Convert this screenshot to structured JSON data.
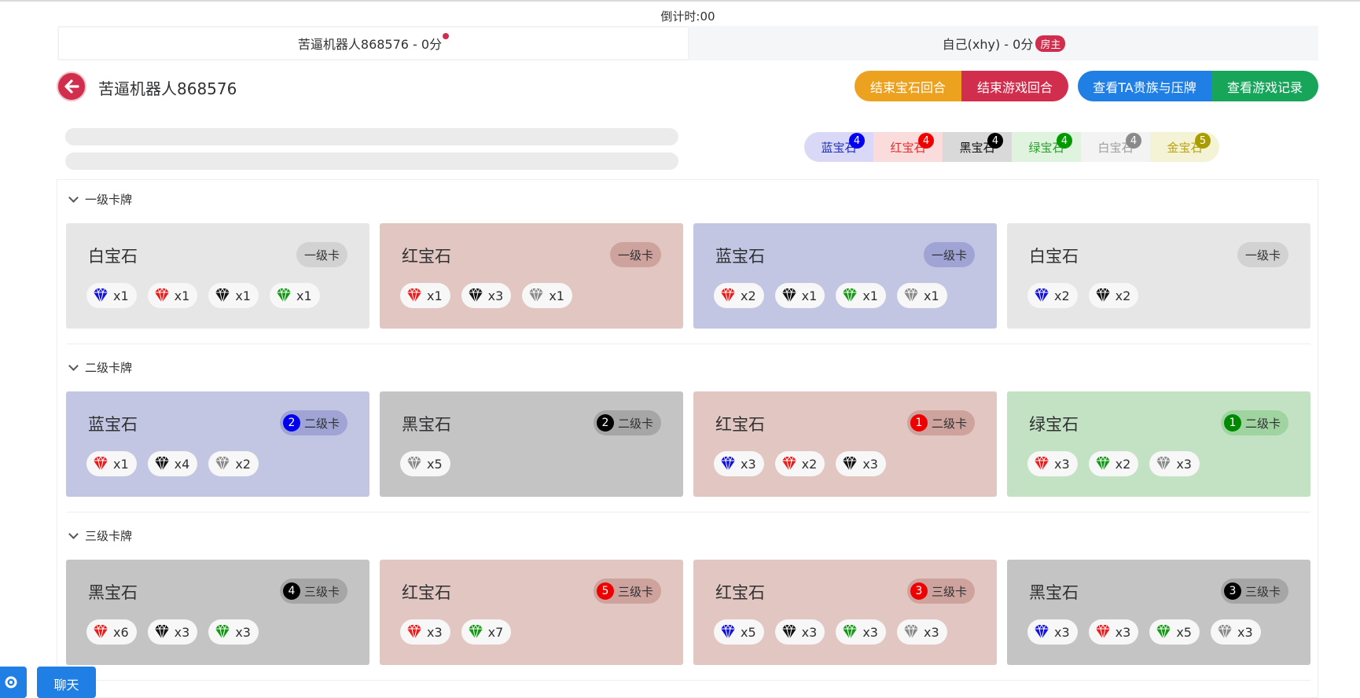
{
  "countdown": "倒计时:00",
  "players": [
    {
      "label": "苦逼机器人868576 - 0分",
      "active": true,
      "dot": true
    },
    {
      "label": "自己(xhy) - 0分",
      "active": false,
      "badge": "房主"
    }
  ],
  "current_player": "苦逼机器人868576",
  "actions": {
    "end_gem_round": "结束宝石回合",
    "end_game_round": "结束游戏回合",
    "view_nobles": "查看TA贵族与压牌",
    "view_records": "查看游戏记录"
  },
  "gem_bank": [
    {
      "name": "蓝宝石",
      "count": "4",
      "text_color": "#1f31b8",
      "bg": "#d9d9f7",
      "badge": "#0000ee"
    },
    {
      "name": "红宝石",
      "count": "4",
      "text_color": "#e0302c",
      "bg": "#fbdcdc",
      "badge": "#ee0000"
    },
    {
      "name": "黑宝石",
      "count": "4",
      "text_color": "#111111",
      "bg": "#d9d9d9",
      "badge": "#000000"
    },
    {
      "name": "绿宝石",
      "count": "4",
      "text_color": "#27a027",
      "bg": "#dff3df",
      "badge": "#009900"
    },
    {
      "name": "白宝石",
      "count": "4",
      "text_color": "#a0a0a0",
      "bg": "#f3f3f3",
      "badge": "#8a8a8a"
    },
    {
      "name": "金宝石",
      "count": "5",
      "text_color": "#b8a30f",
      "bg": "#f5f3d6",
      "badge": "#a89c00"
    }
  ],
  "sections": [
    {
      "title": "一级卡牌",
      "cards": [
        {
          "gem": "白宝石",
          "bg": "#e6e6e6",
          "badge_bg": "#d2d2d2",
          "level": "一级卡",
          "num": "",
          "num_color": "",
          "costs": [
            {
              "color": "blue",
              "qty": "x1"
            },
            {
              "color": "red",
              "qty": "x1"
            },
            {
              "color": "black",
              "qty": "x1"
            },
            {
              "color": "green",
              "qty": "x1"
            }
          ]
        },
        {
          "gem": "红宝石",
          "bg": "#e2c6c2",
          "badge_bg": "#cfa39d",
          "level": "一级卡",
          "num": "",
          "num_color": "",
          "costs": [
            {
              "color": "red",
              "qty": "x1"
            },
            {
              "color": "black",
              "qty": "x3"
            },
            {
              "color": "grey",
              "qty": "x1"
            }
          ]
        },
        {
          "gem": "蓝宝石",
          "bg": "#c3c6e2",
          "badge_bg": "#a0a4d4",
          "level": "一级卡",
          "num": "",
          "num_color": "",
          "costs": [
            {
              "color": "red",
              "qty": "x2"
            },
            {
              "color": "black",
              "qty": "x1"
            },
            {
              "color": "green",
              "qty": "x1"
            },
            {
              "color": "grey",
              "qty": "x1"
            }
          ]
        },
        {
          "gem": "白宝石",
          "bg": "#e6e6e6",
          "badge_bg": "#d2d2d2",
          "level": "一级卡",
          "num": "",
          "num_color": "",
          "costs": [
            {
              "color": "blue",
              "qty": "x2"
            },
            {
              "color": "black",
              "qty": "x2"
            }
          ]
        }
      ]
    },
    {
      "title": "二级卡牌",
      "cards": [
        {
          "gem": "蓝宝石",
          "bg": "#c3c6e2",
          "badge_bg": "#a0a4d4",
          "level": "二级卡",
          "num": "2",
          "num_color": "#0000ee",
          "costs": [
            {
              "color": "red",
              "qty": "x1"
            },
            {
              "color": "black",
              "qty": "x4"
            },
            {
              "color": "grey",
              "qty": "x2"
            }
          ]
        },
        {
          "gem": "黑宝石",
          "bg": "#c4c4c4",
          "badge_bg": "#a6a6a6",
          "level": "二级卡",
          "num": "2",
          "num_color": "#000000",
          "costs": [
            {
              "color": "grey",
              "qty": "x5"
            }
          ]
        },
        {
          "gem": "红宝石",
          "bg": "#e2c6c2",
          "badge_bg": "#cfa39d",
          "level": "二级卡",
          "num": "1",
          "num_color": "#ee0000",
          "costs": [
            {
              "color": "blue",
              "qty": "x3"
            },
            {
              "color": "red",
              "qty": "x2"
            },
            {
              "color": "black",
              "qty": "x3"
            }
          ]
        },
        {
          "gem": "绿宝石",
          "bg": "#c3e2c3",
          "badge_bg": "#9fd39f",
          "level": "二级卡",
          "num": "1",
          "num_color": "#008800",
          "costs": [
            {
              "color": "red",
              "qty": "x3"
            },
            {
              "color": "green",
              "qty": "x2"
            },
            {
              "color": "grey",
              "qty": "x3"
            }
          ]
        }
      ]
    },
    {
      "title": "三级卡牌",
      "cards": [
        {
          "gem": "黑宝石",
          "bg": "#c4c4c4",
          "badge_bg": "#a6a6a6",
          "level": "三级卡",
          "num": "4",
          "num_color": "#000000",
          "costs": [
            {
              "color": "red",
              "qty": "x6"
            },
            {
              "color": "black",
              "qty": "x3"
            },
            {
              "color": "green",
              "qty": "x3"
            }
          ]
        },
        {
          "gem": "红宝石",
          "bg": "#e2c6c2",
          "badge_bg": "#cfa39d",
          "level": "三级卡",
          "num": "5",
          "num_color": "#ee0000",
          "costs": [
            {
              "color": "red",
              "qty": "x3"
            },
            {
              "color": "green",
              "qty": "x7"
            }
          ]
        },
        {
          "gem": "红宝石",
          "bg": "#e2c6c2",
          "badge_bg": "#cfa39d",
          "level": "三级卡",
          "num": "3",
          "num_color": "#ee0000",
          "costs": [
            {
              "color": "blue",
              "qty": "x5"
            },
            {
              "color": "black",
              "qty": "x3"
            },
            {
              "color": "green",
              "qty": "x3"
            },
            {
              "color": "grey",
              "qty": "x3"
            }
          ]
        },
        {
          "gem": "黑宝石",
          "bg": "#c4c4c4",
          "badge_bg": "#a6a6a6",
          "level": "三级卡",
          "num": "3",
          "num_color": "#000000",
          "costs": [
            {
              "color": "blue",
              "qty": "x3"
            },
            {
              "color": "red",
              "qty": "x3"
            },
            {
              "color": "green",
              "qty": "x5"
            },
            {
              "color": "grey",
              "qty": "x3"
            }
          ]
        }
      ]
    }
  ],
  "chat_label": "聊天",
  "gear_icon": "gear-icon",
  "colors": {
    "accent_red": "#d12d4c",
    "orange": "#eda21f",
    "blue": "#1f7fe5",
    "green": "#17a55a"
  }
}
